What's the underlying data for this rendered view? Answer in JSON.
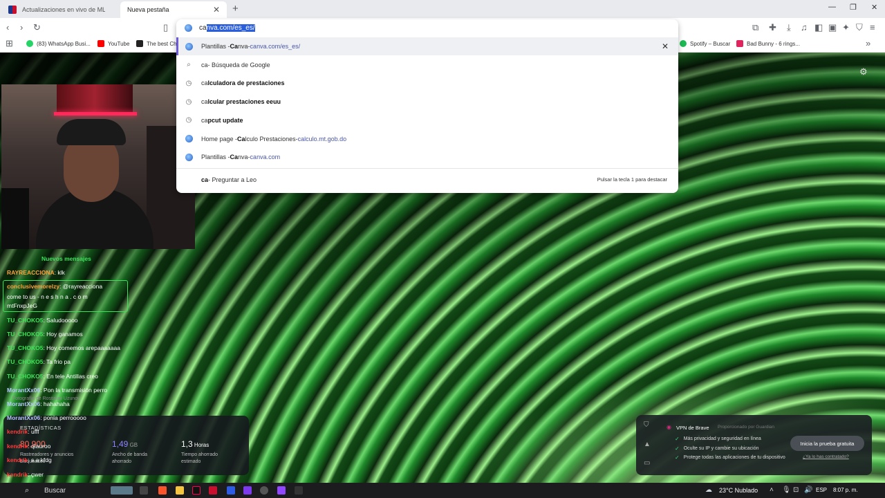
{
  "tabs": [
    {
      "label": "Actualizaciones en vivo de MLB Gam",
      "active": false
    },
    {
      "label": "Nueva pestaña",
      "active": true
    }
  ],
  "toolbar": {
    "new_tab": "+",
    "address_typed": "ca",
    "address_completion": "nva.com/es_es/"
  },
  "bookmarks": [
    {
      "label": "(83) WhatsApp Busi...",
      "color": "#25d366"
    },
    {
      "label": "YouTube",
      "color": "#ff0000"
    },
    {
      "label": "The best Ch",
      "color": "#222222"
    },
    {
      "label": "Spotify – Buscar",
      "color": "#1db954"
    },
    {
      "label": "Bad Bunny - 6 rings...",
      "color": "#e0245e"
    }
  ],
  "suggestions": [
    {
      "icon": "globe-icon",
      "parts": [
        {
          "t": "Plantillas - ",
          "s": "n"
        },
        {
          "t": "Ca",
          "s": "b"
        },
        {
          "t": "nva",
          "s": "n"
        },
        {
          "t": " - ",
          "s": "n"
        },
        {
          "t": "ca",
          "s": "u"
        },
        {
          "t": "nva.com/es_es/",
          "s": "u"
        }
      ],
      "highlighted": true
    },
    {
      "icon": "search-icon",
      "parts": [
        {
          "t": "ca",
          "s": "n"
        },
        {
          "t": " - Búsqueda de Google",
          "s": "n"
        }
      ]
    },
    {
      "icon": "history-icon",
      "parts": [
        {
          "t": "ca",
          "s": "n"
        },
        {
          "t": "lculadora de prestaciones",
          "s": "b"
        }
      ]
    },
    {
      "icon": "history-icon",
      "parts": [
        {
          "t": "ca",
          "s": "n"
        },
        {
          "t": "lcular prestaciones eeuu",
          "s": "b"
        }
      ]
    },
    {
      "icon": "history-icon",
      "parts": [
        {
          "t": "ca",
          "s": "n"
        },
        {
          "t": "pcut update",
          "s": "b"
        }
      ]
    },
    {
      "icon": "globe-icon",
      "parts": [
        {
          "t": "Home page - ",
          "s": "n"
        },
        {
          "t": "Ca",
          "s": "b"
        },
        {
          "t": "lculo Prestaciones",
          "s": "n"
        },
        {
          "t": " - ",
          "s": "n"
        },
        {
          "t": "ca",
          "s": "u"
        },
        {
          "t": "lculo.mt.gob.do",
          "s": "u"
        }
      ]
    },
    {
      "icon": "globe-icon",
      "parts": [
        {
          "t": "Plantillas - ",
          "s": "n"
        },
        {
          "t": "Ca",
          "s": "b"
        },
        {
          "t": "nva",
          "s": "n"
        },
        {
          "t": " - ",
          "s": "n"
        },
        {
          "t": "ca",
          "s": "u"
        },
        {
          "t": "nva.com",
          "s": "u"
        }
      ]
    }
  ],
  "leo": {
    "query": "ca",
    "label": " - Preguntar a Leo",
    "hint": "Pulsar la tecla 1 para destacar"
  },
  "chat": {
    "new_messages": "Nuevos mensajes",
    "messages": [
      {
        "user": "RAYREACCIONA",
        "text": ": klk",
        "color": "orange"
      },
      {
        "user": "conclusivemorelzy",
        "text": ": @rayreacciona",
        "color": "orange"
      },
      {
        "user": "",
        "text": "come to us - n e s h n a . c o m",
        "color": "white"
      },
      {
        "user": "",
        "text": "mtFnxpJeG",
        "color": "white"
      },
      {
        "user": "TU_CHOKO5",
        "text": ": Saludooooo",
        "color": "green"
      },
      {
        "user": "TU_CHOKO5",
        "text": ": Hoy ganamos",
        "color": "green"
      },
      {
        "user": "TU_CHOKO5",
        "text": ": Hoy comemos arepaaaaaaa",
        "color": "green"
      },
      {
        "user": "TU_CHOKO5",
        "text": ": Ta frio pa",
        "color": "green"
      },
      {
        "user": "TU_CHOKO5",
        "text": ": En tele Antillas creo",
        "color": "green"
      },
      {
        "user": "MorantXx06",
        "text": ": Pon la transmisión perro",
        "color": "blue"
      },
      {
        "user": "MorantXx06",
        "text": ": hahahaha",
        "color": "blue"
      },
      {
        "user": "MorantXx06",
        "text": ": ponla perrooooo",
        "color": "blue"
      },
      {
        "user": "kendrik",
        "text": ": ufff",
        "color": "red"
      },
      {
        "user": "kendrik",
        "text": ": qlauroo",
        "color": "red"
      },
      {
        "user": "kendrik",
        "text": ": s.a kfdg",
        "color": "red"
      },
      {
        "user": "kendrik",
        "text": ": çwer",
        "color": "red"
      }
    ]
  },
  "photo_credit": "Fotografía de Rostislav Uzunov",
  "stats": {
    "title": "ESTADÍSTICAS",
    "items": [
      {
        "value": "80,900",
        "unit": "",
        "desc1": "Rastreadores y anuncios",
        "desc2": "bloqueados",
        "color": "red"
      },
      {
        "value": "1,49",
        "unit": " GB",
        "desc1": "Ancho de banda",
        "desc2": "ahorrado",
        "color": "purple"
      },
      {
        "value": "1,3",
        "unit": " Horas",
        "desc1": "Tiempo ahorrado",
        "desc2": "estimado",
        "color": "white"
      }
    ]
  },
  "vpn": {
    "title": "VPN de Brave",
    "provider": "Proporcionado por  Guardian",
    "features": [
      "Más privacidad y seguridad en línea",
      "Oculte su IP y cambie su ubicación",
      "Protege todas las aplicaciones de tu dispositivo"
    ],
    "cta": "Inicia la prueba gratuita",
    "link": "¿Ya lo has contratado?"
  },
  "taskbar": {
    "search": "Buscar",
    "weather": "23°C  Nublado",
    "lang": "ESP",
    "time": "8:07 p. m."
  }
}
